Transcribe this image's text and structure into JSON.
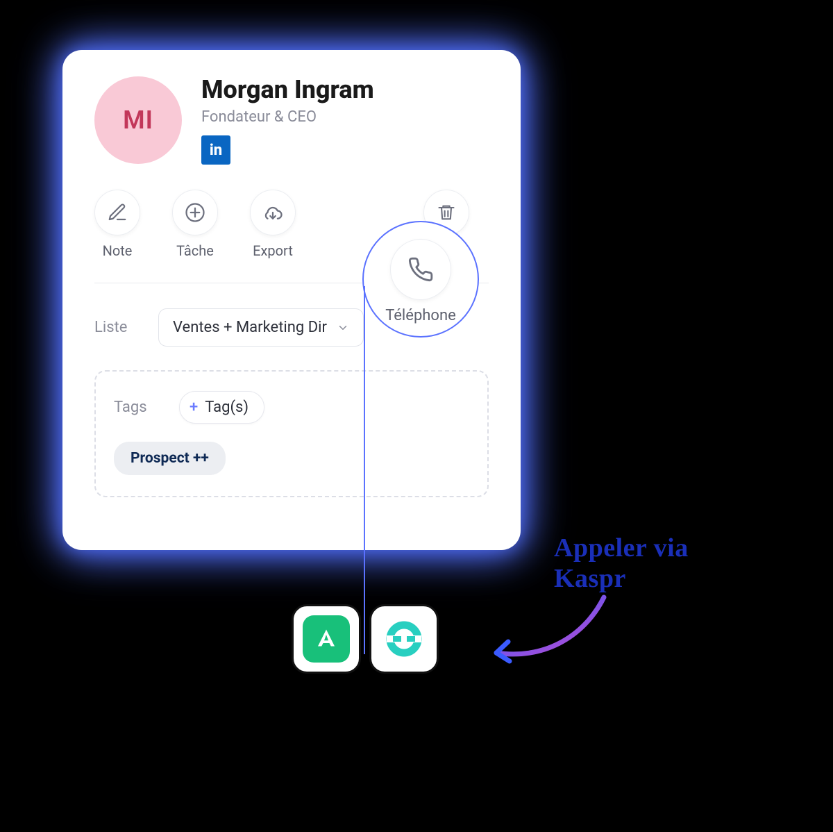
{
  "profile": {
    "initials": "MI",
    "name": "Morgan Ingram",
    "role": "Fondateur & CEO",
    "linkedin_label": "in"
  },
  "actions": {
    "note": "Note",
    "task": "Tâche",
    "export": "Export",
    "phone": "Téléphone",
    "delete": "Suppr."
  },
  "list": {
    "label": "Liste",
    "selected": "Ventes + Marketing Dir"
  },
  "tags": {
    "label": "Tags",
    "add_button": "Tag(s)",
    "chip": "Prospect ++"
  },
  "callout": {
    "text_line1": "Appeler via",
    "text_line2": "Kaspr"
  },
  "apps": {
    "aircall": "Aircall",
    "ringover": "Ringover"
  }
}
